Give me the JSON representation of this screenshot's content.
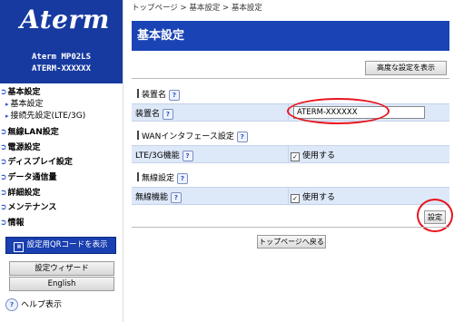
{
  "sidebar": {
    "logo": "Aterm",
    "model": "Aterm MP02LS",
    "device_name": "ATERM-XXXXXX",
    "nav": [
      {
        "label": "基本設定",
        "children": [
          "基本設定",
          "接続先設定(LTE/3G)"
        ]
      },
      {
        "label": "無線LAN設定"
      },
      {
        "label": "電源設定"
      },
      {
        "label": "ディスプレイ設定"
      },
      {
        "label": "データ通信量"
      },
      {
        "label": "詳細設定"
      },
      {
        "label": "メンテナンス"
      },
      {
        "label": "情報"
      }
    ],
    "qr_button": "設定用QRコードを表示",
    "wizard_button": "設定ウィザード",
    "english_button": "English",
    "help": "ヘルプ表示"
  },
  "main": {
    "breadcrumb": "トップページ > 基本設定 > 基本設定",
    "title": "基本設定",
    "advanced_button": "高度な設定を表示",
    "sections": [
      {
        "title": "装置名",
        "rows": [
          {
            "label": "装置名",
            "input_value": "ATERM-XXXXXX"
          }
        ]
      },
      {
        "title": "WANインタフェース設定",
        "rows": [
          {
            "label": "LTE/3G機能",
            "checkbox_label": "使用する",
            "checked": true
          }
        ]
      },
      {
        "title": "無線設定",
        "rows": [
          {
            "label": "無線機能",
            "checkbox_label": "使用する",
            "checked": true
          }
        ]
      }
    ],
    "set_button": "設定",
    "top_button": "トップページへ戻る"
  },
  "colors": {
    "brand_blue": "#1a44b6",
    "highlight_red": "#e8141e",
    "row_bg": "#dde8f8"
  },
  "icons": {
    "help": "question-mark-icon",
    "nav_arrow": "arrow-right-icon",
    "checkbox": "checkbox-icon",
    "qr": "qr-code-icon"
  }
}
